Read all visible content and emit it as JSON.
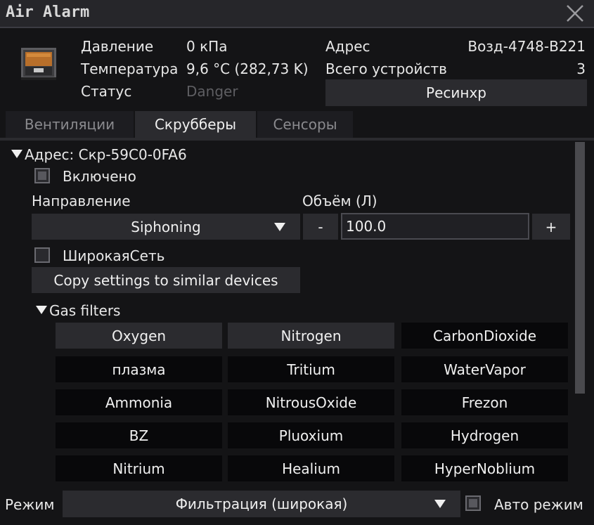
{
  "window": {
    "title": "Air Alarm"
  },
  "info": {
    "pressure_label": "Давление",
    "pressure_value": "0 кПа",
    "temperature_label": "Температура",
    "temperature_value": "9,6 °C (282,73 K)",
    "status_label": "Статус",
    "status_value": "Danger",
    "address_label": "Адрес",
    "address_value": "Возд-4748-B221",
    "devices_label": "Всего устройств",
    "devices_value": "3",
    "resync_label": "Ресинхр"
  },
  "tabs": [
    {
      "label": "Вентиляции",
      "active": false
    },
    {
      "label": "Скрубберы",
      "active": true
    },
    {
      "label": "Сенсоры",
      "active": false
    }
  ],
  "scrubber": {
    "address": "Адрес: Скр-59C0-0FA6",
    "enabled_label": "Включено",
    "direction_label": "Направление",
    "direction_value": "Siphoning",
    "volume_label": "Объём (Л)",
    "minus": "-",
    "volume_value": "100.0",
    "plus": "+",
    "widenet_label": "ШирокаяСеть",
    "copy_label": "Copy settings to similar devices",
    "filters_label": "Gas filters",
    "gases": [
      {
        "name": "Oxygen",
        "on": true
      },
      {
        "name": "Nitrogen",
        "on": true
      },
      {
        "name": "CarbonDioxide",
        "on": false
      },
      {
        "name": "плазма",
        "on": false
      },
      {
        "name": "Tritium",
        "on": false
      },
      {
        "name": "WaterVapor",
        "on": false
      },
      {
        "name": "Ammonia",
        "on": false
      },
      {
        "name": "NitrousOxide",
        "on": false
      },
      {
        "name": "Frezon",
        "on": false
      },
      {
        "name": "BZ",
        "on": false
      },
      {
        "name": "Pluoxium",
        "on": false
      },
      {
        "name": "Hydrogen",
        "on": false
      },
      {
        "name": "Nitrium",
        "on": false
      },
      {
        "name": "Healium",
        "on": false
      },
      {
        "name": "HyperNoblium",
        "on": false
      }
    ]
  },
  "mode": {
    "label": "Режим",
    "value": "Фильтрация (широкая)",
    "auto_label": "Авто режим"
  },
  "colors": {
    "background": "#141416",
    "button": "#2b2b2f",
    "status_dim": "#5e5e62"
  },
  "icons": {
    "close": "close-icon",
    "device": "air-alarm-icon"
  }
}
